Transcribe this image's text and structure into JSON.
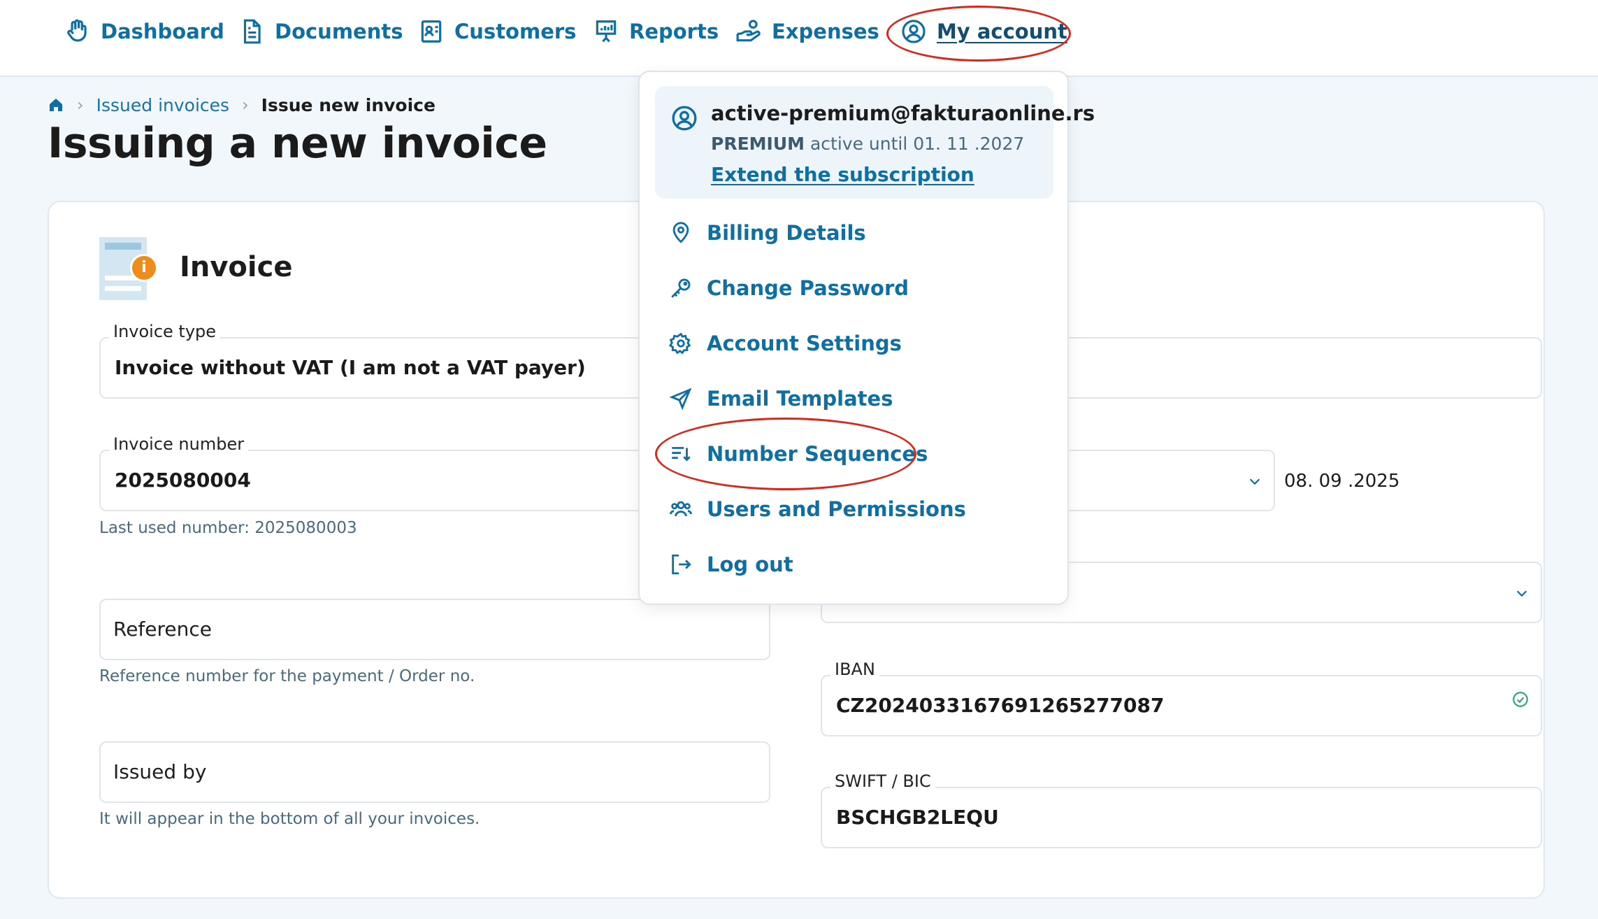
{
  "nav": {
    "items": [
      {
        "label": "Dashboard",
        "icon": "hand-wave-icon"
      },
      {
        "label": "Documents",
        "icon": "document-icon"
      },
      {
        "label": "Customers",
        "icon": "contact-card-icon"
      },
      {
        "label": "Reports",
        "icon": "presentation-chart-icon"
      },
      {
        "label": "Expenses",
        "icon": "hand-coin-icon"
      }
    ],
    "account_label": "My account"
  },
  "breadcrumb": {
    "home_icon": "home-icon",
    "parent": "Issued invoices",
    "current": "Issue new invoice"
  },
  "page": {
    "title": "Issuing a new invoice"
  },
  "invoice_section": {
    "title": "Invoice"
  },
  "form": {
    "invoice_type": {
      "label": "Invoice type",
      "value": "Invoice without VAT (I am not a VAT payer)"
    },
    "invoice_number": {
      "label": "Invoice number",
      "value": "2025080004",
      "hint": "Last used number: 2025080003"
    },
    "date_value": "08. 09 .2025",
    "reference": {
      "placeholder": "Reference",
      "hint": "Reference number for the payment / Order no."
    },
    "issued_by": {
      "placeholder": "Issued by",
      "hint": "It will appear in the bottom of all your invoices."
    },
    "iban": {
      "label": "IBAN",
      "value": "CZ2024033167691265277087"
    },
    "swift": {
      "label": "SWIFT / BIC",
      "value": "BSCHGB2LEQU"
    }
  },
  "account_menu": {
    "email": "active-premium@fakturaonline.rs",
    "plan": "PREMIUM",
    "plan_status": "active until 01. 11 .2027",
    "extend_link": "Extend the subscription",
    "items": [
      {
        "label": "Billing Details",
        "icon": "map-pin-icon"
      },
      {
        "label": "Change Password",
        "icon": "key-icon"
      },
      {
        "label": "Account Settings",
        "icon": "gear-icon"
      },
      {
        "label": "Email Templates",
        "icon": "paper-plane-icon"
      },
      {
        "label": "Number Sequences",
        "icon": "sort-list-icon"
      },
      {
        "label": "Users and Permissions",
        "icon": "users-icon"
      },
      {
        "label": "Log out",
        "icon": "logout-icon"
      }
    ]
  },
  "colors": {
    "accent": "#0f6fa3",
    "annotation": "#d9271c",
    "invoice_badge": "#f08c1b"
  }
}
